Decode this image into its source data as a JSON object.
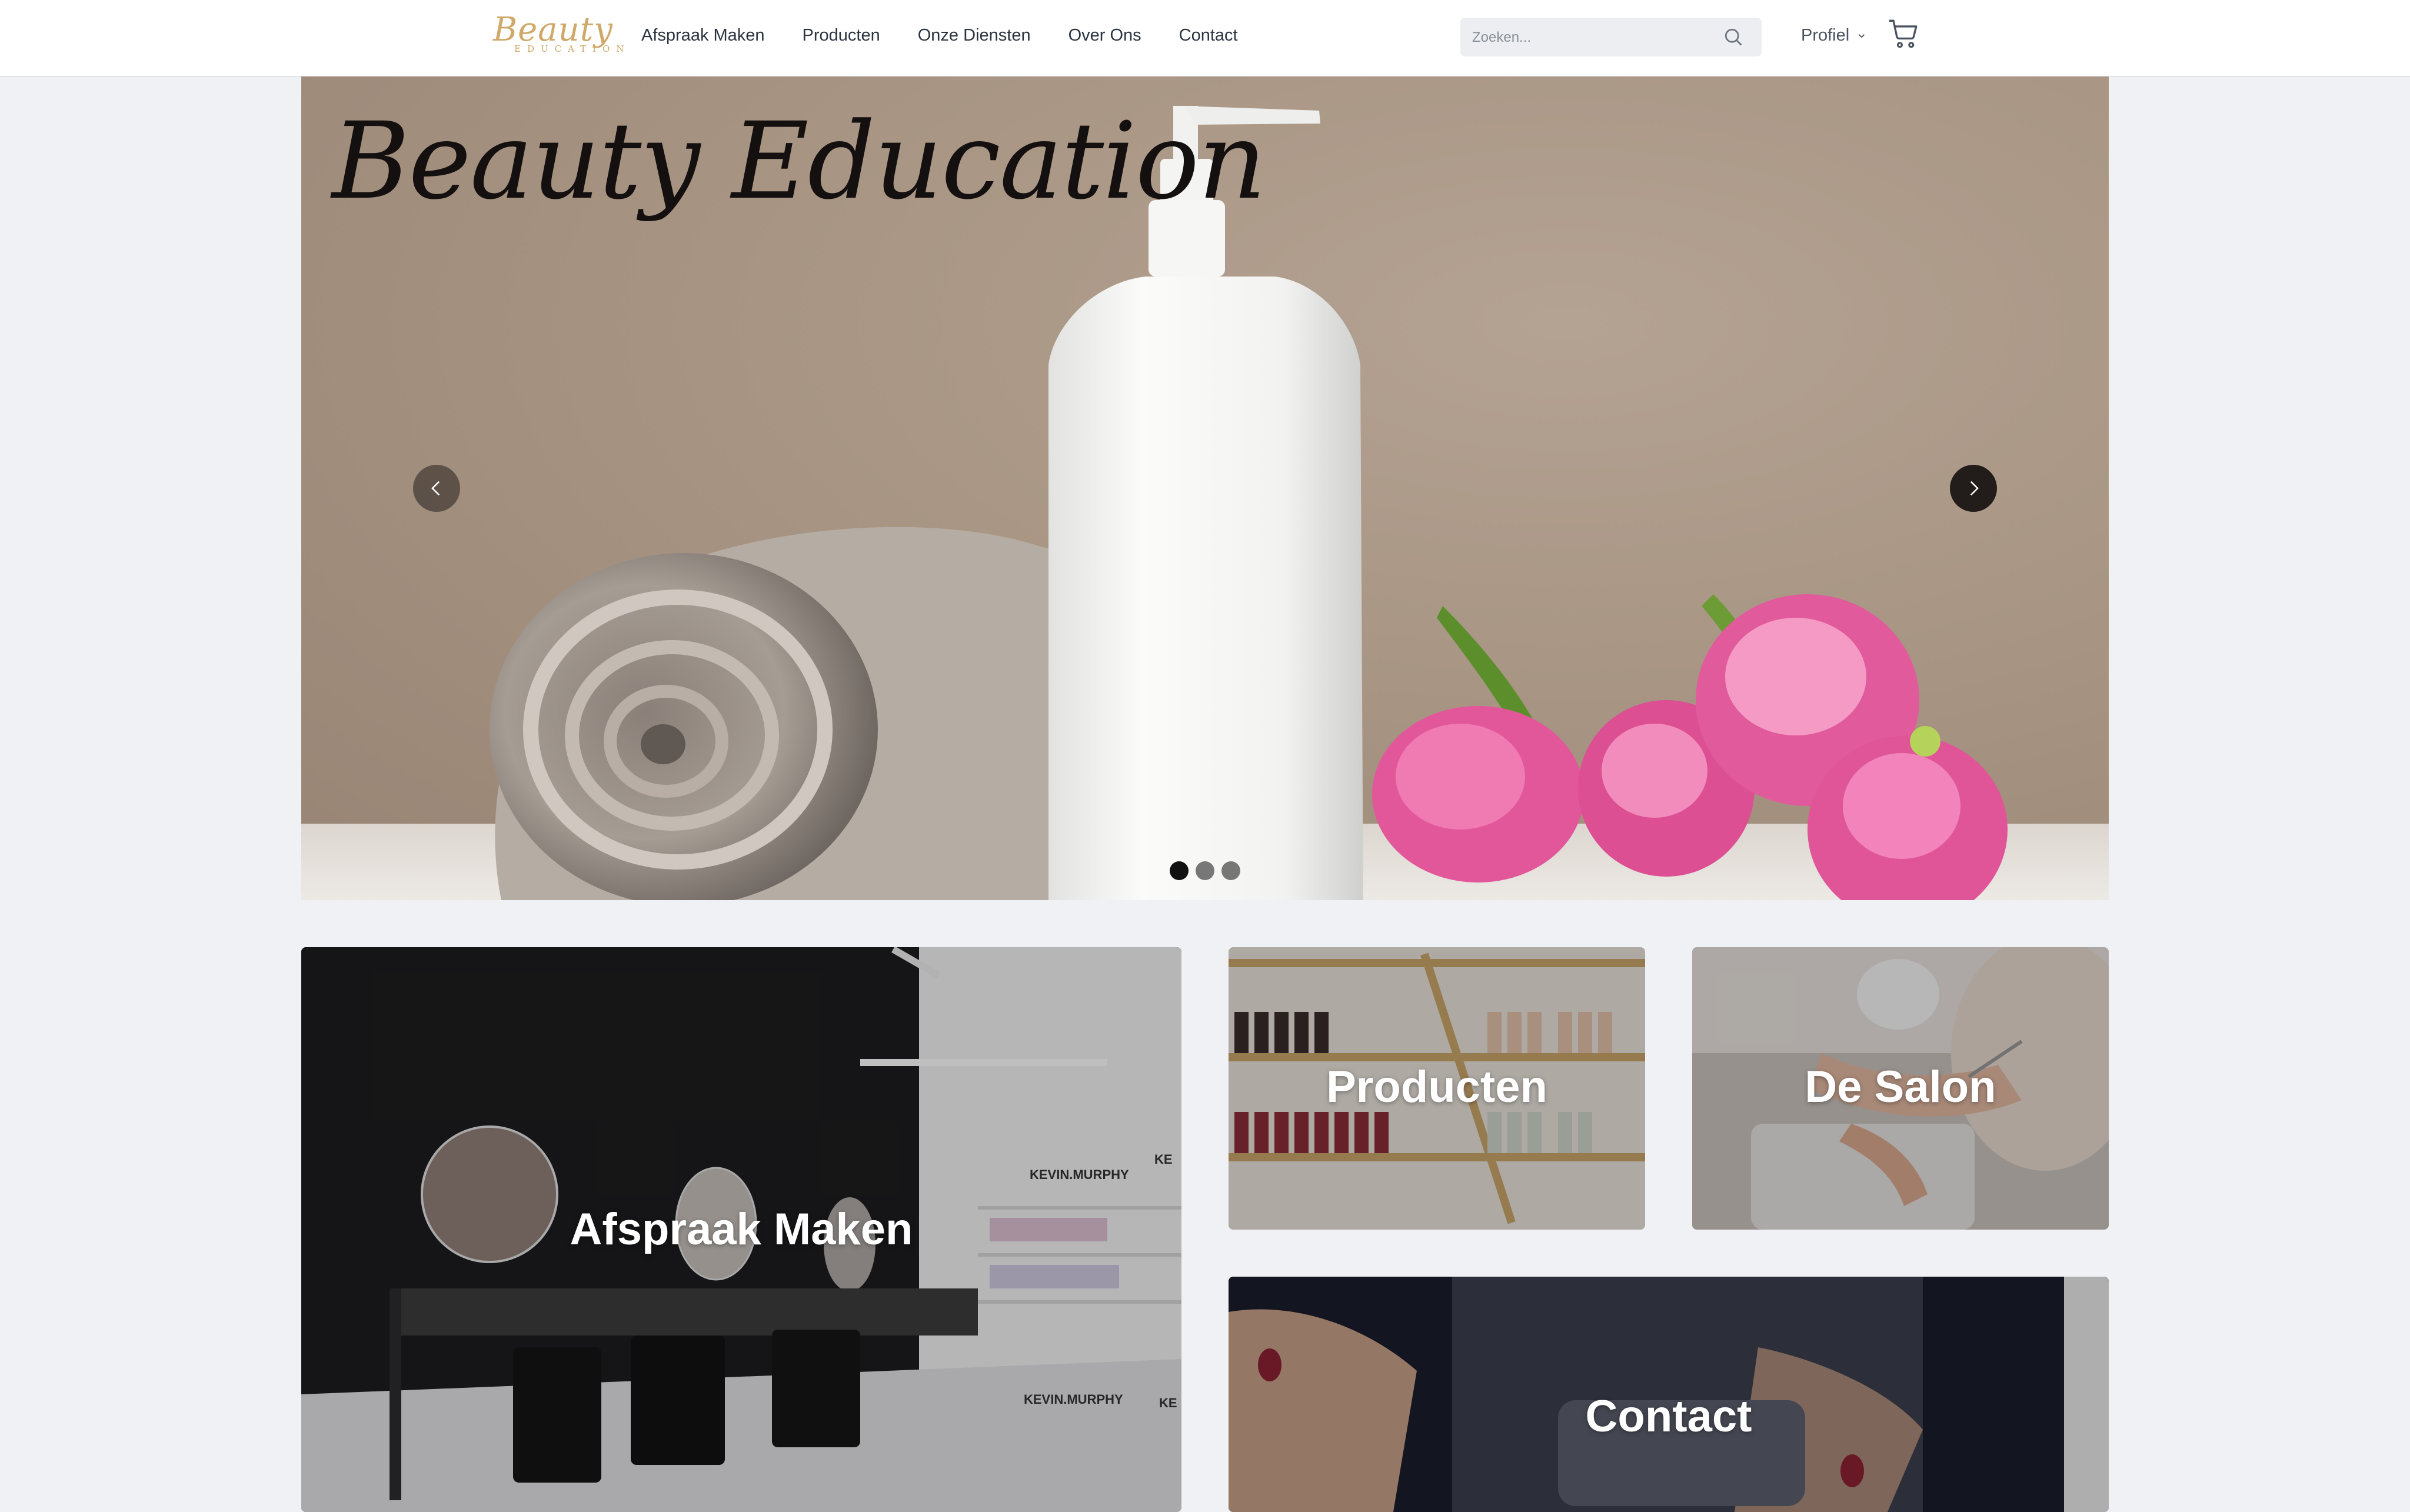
{
  "header": {
    "logo": {
      "script": "Beauty",
      "sub": "EDUCATION"
    },
    "nav": [
      {
        "label": "Afspraak Maken"
      },
      {
        "label": "Producten"
      },
      {
        "label": "Onze Diensten"
      },
      {
        "label": "Over Ons"
      },
      {
        "label": "Contact"
      }
    ],
    "search": {
      "placeholder": "Zoeken...",
      "value": ""
    },
    "profile_label": "Profiel"
  },
  "hero": {
    "title": "Beauty Education",
    "slide_count": 3,
    "active_slide": 0
  },
  "tiles": {
    "afspraak": {
      "label": "Afspraak Maken",
      "wall_brand": "KEVIN.MURPHY",
      "wall_brand_short": "KE"
    },
    "producten": {
      "label": "Producten"
    },
    "salon": {
      "label": "De Salon"
    },
    "contact": {
      "label": "Contact"
    }
  },
  "colors": {
    "accent_gold": "#cfa86a",
    "nav_text": "#2b3340",
    "page_bg": "#f0f1f4",
    "tulip_pink": "#e2579a"
  }
}
